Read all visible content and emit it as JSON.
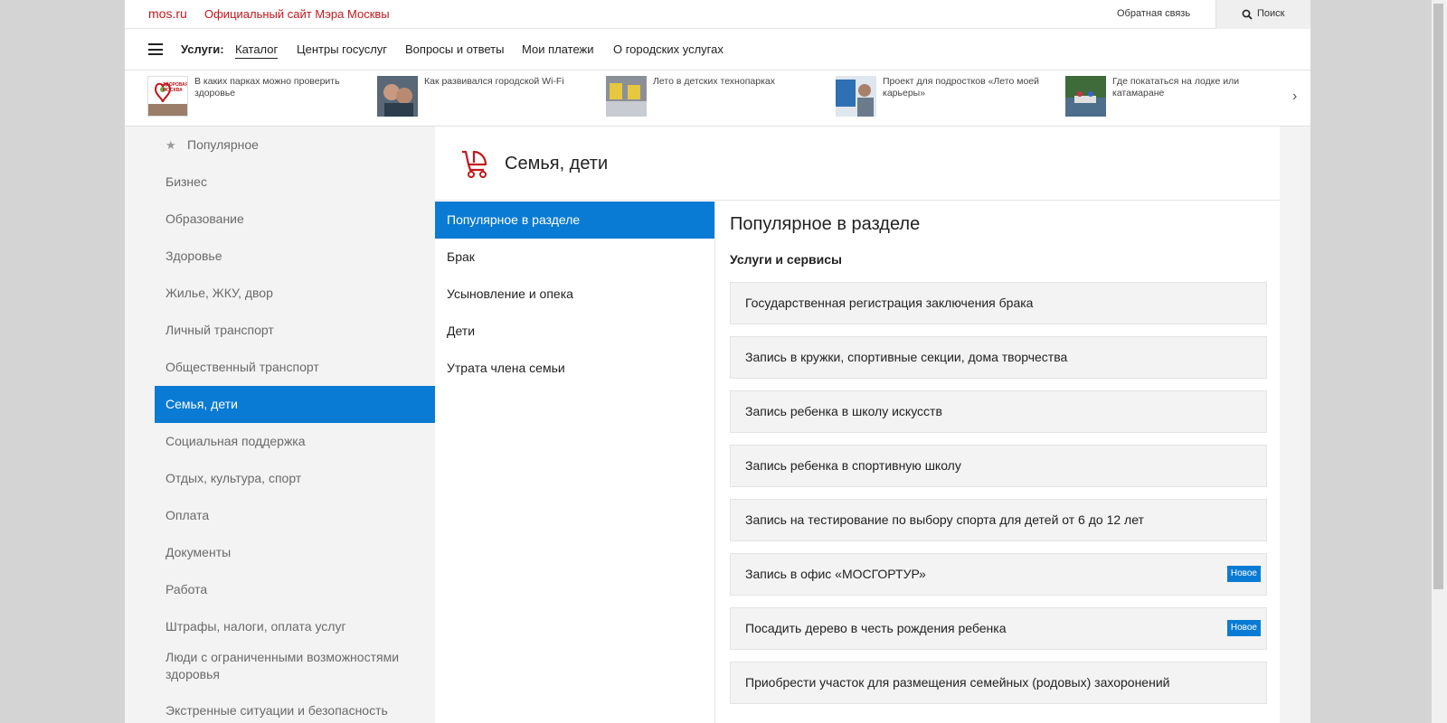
{
  "topbar": {
    "logo": "mos.ru",
    "site_title": "Официальный сайт Мэра Москвы",
    "feedback": "Обратная связь",
    "search": "Поиск"
  },
  "nav": {
    "label": "Услуги:",
    "items": [
      {
        "label": "Каталог",
        "active": true
      },
      {
        "label": "Центры госуслуг"
      },
      {
        "label": "Вопросы и ответы"
      },
      {
        "label": "Мои платежи"
      },
      {
        "label": "О городских услугах"
      }
    ]
  },
  "news": [
    {
      "text": "В каких парках можно проверить здоровье",
      "thumb_logo": "ЗДОРОВАЯ МОСКВА"
    },
    {
      "text": "Как развивался городской Wi-Fi"
    },
    {
      "text": "Лето в детских технопарках"
    },
    {
      "text": "Проект для подростков «Лето моей карьеры»"
    },
    {
      "text": "Где покататься на лодке или катамаране"
    }
  ],
  "categories": [
    {
      "label": "Популярное",
      "icon": "star-icon"
    },
    {
      "label": "Бизнес"
    },
    {
      "label": "Образование"
    },
    {
      "label": "Здоровье"
    },
    {
      "label": "Жилье, ЖКУ, двор"
    },
    {
      "label": "Личный транспорт"
    },
    {
      "label": "Общественный транспорт"
    },
    {
      "label": "Семья, дети",
      "active": true
    },
    {
      "label": "Социальная поддержка"
    },
    {
      "label": "Отдых, культура, спорт"
    },
    {
      "label": "Оплата"
    },
    {
      "label": "Документы"
    },
    {
      "label": "Работа"
    },
    {
      "label": "Штрафы, налоги, оплата услуг"
    },
    {
      "label": "Люди с ограниченными возможностями здоровья"
    },
    {
      "label": "Экстренные ситуации и безопасность"
    }
  ],
  "section": {
    "title": "Семья, дети",
    "icon": "stroller-icon",
    "subsections": [
      {
        "label": "Популярное в разделе",
        "active": true
      },
      {
        "label": "Брак"
      },
      {
        "label": "Усыновление и опека"
      },
      {
        "label": "Дети"
      },
      {
        "label": "Утрата члена семьи"
      }
    ]
  },
  "panel": {
    "title": "Популярное в разделе",
    "subtitle": "Услуги и сервисы",
    "services": [
      {
        "label": "Государственная регистрация заключения брака"
      },
      {
        "label": "Запись в кружки, спортивные секции, дома творчества"
      },
      {
        "label": "Запись ребенка в школу искусств"
      },
      {
        "label": "Запись ребенка в спортивную школу"
      },
      {
        "label": "Запись на тестирование по выбору спорта для детей от 6 до 12 лет"
      },
      {
        "label": "Запись в офис «МОСГОРТУР»",
        "badge": "Новое"
      },
      {
        "label": "Посадить дерево в честь рождения ребенка",
        "badge": "Новое"
      },
      {
        "label": "Приобрести участок для размещения семейных (родовых) захоронений"
      }
    ]
  },
  "colors": {
    "accent": "#0a7bd4",
    "brand_red": "#c2181c"
  }
}
